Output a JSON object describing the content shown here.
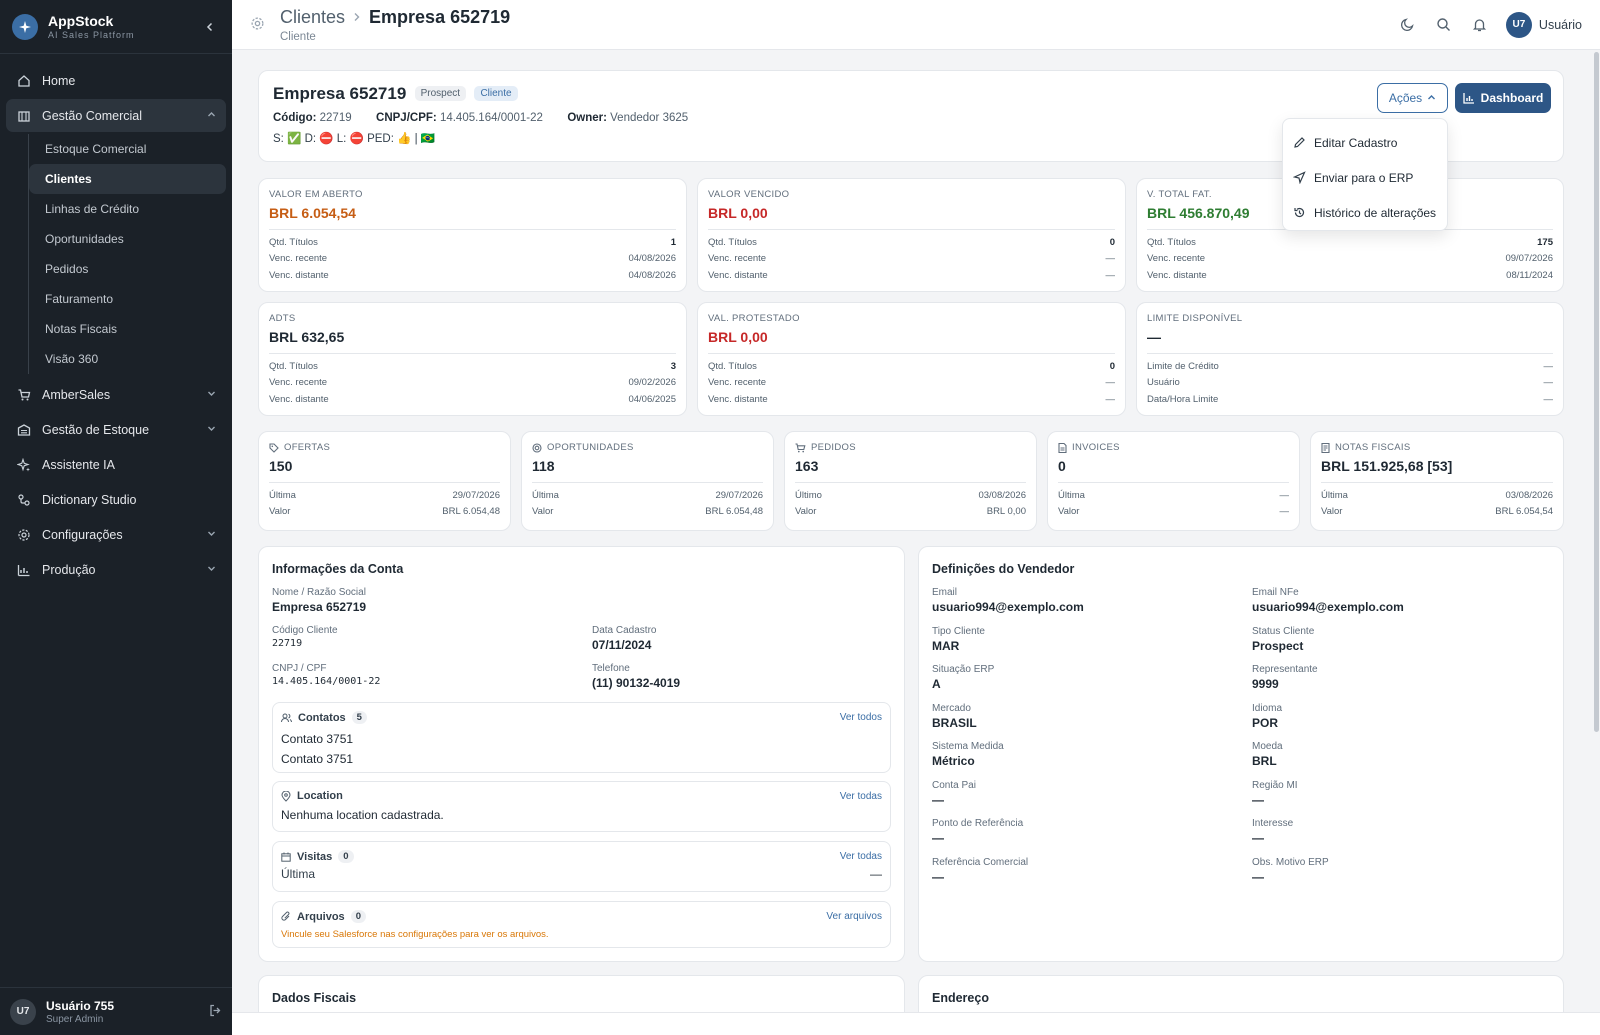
{
  "brand": {
    "name": "AppStock",
    "sub": "AI Sales Platform"
  },
  "sidebar": {
    "items": [
      {
        "label": "Home",
        "icon": "home-icon"
      },
      {
        "label": "Gestão Comercial",
        "icon": "building-icon"
      },
      {
        "label": "AmberSales",
        "icon": "cart-icon"
      },
      {
        "label": "Gestão de Estoque",
        "icon": "warehouse-icon"
      },
      {
        "label": "Assistente IA",
        "icon": "sparkle-icon"
      },
      {
        "label": "Dictionary Studio",
        "icon": "nodes-icon"
      },
      {
        "label": "Configurações",
        "icon": "gear-icon"
      },
      {
        "label": "Produção",
        "icon": "factory-icon"
      }
    ],
    "sub": [
      "Estoque Comercial",
      "Clientes",
      "Linhas de Crédito",
      "Oportunidades",
      "Pedidos",
      "Faturamento",
      "Notas Fiscais",
      "Visão 360"
    ],
    "user": {
      "initials": "U7",
      "name": "Usuário 755",
      "role": "Super Admin"
    }
  },
  "header": {
    "parent": "Clientes",
    "current": "Empresa 652719",
    "sub": "Cliente",
    "user_initials": "U7",
    "user_name": "Usuário"
  },
  "company": {
    "name": "Empresa 652719",
    "badges": [
      "Prospect",
      "Cliente"
    ],
    "codigo_label": "Código:",
    "codigo": "22719",
    "cnpj_label": "CNPJ/CPF:",
    "cnpj": "14.405.164/0001-22",
    "owner_label": "Owner:",
    "owner": "Vendedor 3625",
    "status": "S: ✅ D: ⛔ L: ⛔ PED: 👍 | 🇧🇷",
    "acoes": "Ações",
    "dashboard": "Dashboard"
  },
  "actions_menu": [
    "Editar Cadastro",
    "Enviar para o ERP",
    "Histórico de alterações"
  ],
  "kpis_top": [
    {
      "label": "VALOR EM ABERTO",
      "value": "BRL 6.054,54",
      "rows": [
        [
          "Qtd. Títulos",
          "1"
        ],
        [
          "Venc. recente",
          "04/08/2026"
        ],
        [
          "Venc. distante",
          "04/08/2026"
        ]
      ]
    },
    {
      "label": "VALOR VENCIDO",
      "value": "BRL 0,00",
      "rows": [
        [
          "Qtd. Títulos",
          "0"
        ],
        [
          "Venc. recente",
          "—"
        ],
        [
          "Venc. distante",
          "—"
        ]
      ]
    },
    {
      "label": "V. TOTAL FAT.",
      "value": "BRL 456.870,49",
      "rows": [
        [
          "Qtd. Títulos",
          "175"
        ],
        [
          "Venc. recente",
          "09/07/2026"
        ],
        [
          "Venc. distante",
          "08/11/2024"
        ]
      ]
    },
    {
      "label": "ADTS",
      "value": "BRL 632,65",
      "rows": [
        [
          "Qtd. Títulos",
          "3"
        ],
        [
          "Venc. recente",
          "09/02/2026"
        ],
        [
          "Venc. distante",
          "04/06/2025"
        ]
      ]
    },
    {
      "label": "VAL. PROTESTADO",
      "value": "BRL 0,00",
      "rows": [
        [
          "Qtd. Títulos",
          "0"
        ],
        [
          "Venc. recente",
          "—"
        ],
        [
          "Venc. distante",
          "—"
        ]
      ]
    },
    {
      "label": "LIMITE DISPONÍVEL",
      "value": "—",
      "rows": [
        [
          "Limite de Crédito",
          "—"
        ],
        [
          "Usuário",
          "—"
        ],
        [
          "Data/Hora Limite",
          "—"
        ]
      ]
    }
  ],
  "kpis_small": [
    {
      "label": "OFERTAS",
      "icon": "tag-icon",
      "value": "150",
      "rows": [
        [
          "Última",
          "29/07/2026"
        ],
        [
          "Valor",
          "BRL 6.054,48"
        ]
      ]
    },
    {
      "label": "OPORTUNIDADES",
      "icon": "target-icon",
      "value": "118",
      "rows": [
        [
          "Última",
          "29/07/2026"
        ],
        [
          "Valor",
          "BRL 6.054,48"
        ]
      ]
    },
    {
      "label": "PEDIDOS",
      "icon": "cart-icon",
      "value": "163",
      "rows": [
        [
          "Último",
          "03/08/2026"
        ],
        [
          "Valor",
          "BRL 0,00"
        ]
      ]
    },
    {
      "label": "INVOICES",
      "icon": "document-icon",
      "value": "0",
      "rows": [
        [
          "Última",
          "—"
        ],
        [
          "Valor",
          "—"
        ]
      ]
    },
    {
      "label": "NOTAS FISCAIS",
      "icon": "receipt-icon",
      "value": "BRL 151.925,68 [53]",
      "rows": [
        [
          "Última",
          "03/08/2026"
        ],
        [
          "Valor",
          "BRL 6.054,54"
        ]
      ]
    }
  ],
  "account": {
    "title": "Informações da Conta",
    "fields": [
      {
        "label": "Nome / Razão Social",
        "value": "Empresa 652719"
      },
      {
        "label": "Código Cliente",
        "value": "22719"
      },
      {
        "label": "Data Cadastro",
        "value": "07/11/2024"
      },
      {
        "label": "CNPJ / CPF",
        "value": "14.405.164/0001-22"
      },
      {
        "label": "Telefone",
        "value": "(11) 90132-4019"
      }
    ],
    "contatos": {
      "title": "Contatos",
      "count": "5",
      "link": "Ver todos",
      "items": [
        "Contato 3751",
        "Contato 3751"
      ]
    },
    "location": {
      "title": "Location",
      "link": "Ver todas",
      "text": "Nenhuma location cadastrada."
    },
    "visitas": {
      "title": "Visitas",
      "count": "0",
      "link": "Ver todas",
      "label": "Última",
      "value": "—"
    },
    "arquivos": {
      "title": "Arquivos",
      "count": "0",
      "link": "Ver arquivos",
      "warning": "Vincule seu Salesforce nas configurações para ver os arquivos."
    }
  },
  "seller": {
    "title": "Definições do Vendedor",
    "fields": [
      {
        "label": "Email",
        "value": "usuario994@exemplo.com"
      },
      {
        "label": "Email NFe",
        "value": "usuario994@exemplo.com"
      },
      {
        "label": "Tipo Cliente",
        "value": "MAR"
      },
      {
        "label": "Status Cliente",
        "value": "Prospect"
      },
      {
        "label": "Situação ERP",
        "value": "A"
      },
      {
        "label": "Representante",
        "value": "9999"
      },
      {
        "label": "Mercado",
        "value": "BRASIL"
      },
      {
        "label": "Idioma",
        "value": "POR"
      },
      {
        "label": "Sistema Medida",
        "value": "Métrico"
      },
      {
        "label": "Moeda",
        "value": "BRL"
      },
      {
        "label": "Conta Pai",
        "value": "—"
      },
      {
        "label": "Região MI",
        "value": "—"
      },
      {
        "label": "Ponto de Referência",
        "value": "—"
      },
      {
        "label": "Interesse",
        "value": "—"
      },
      {
        "label": "Referência Comercial",
        "value": "—"
      },
      {
        "label": "Obs. Motivo ERP",
        "value": "—"
      }
    ]
  },
  "bottom": {
    "fiscal_title": "Dados Fiscais",
    "address_title": "Endereço"
  }
}
